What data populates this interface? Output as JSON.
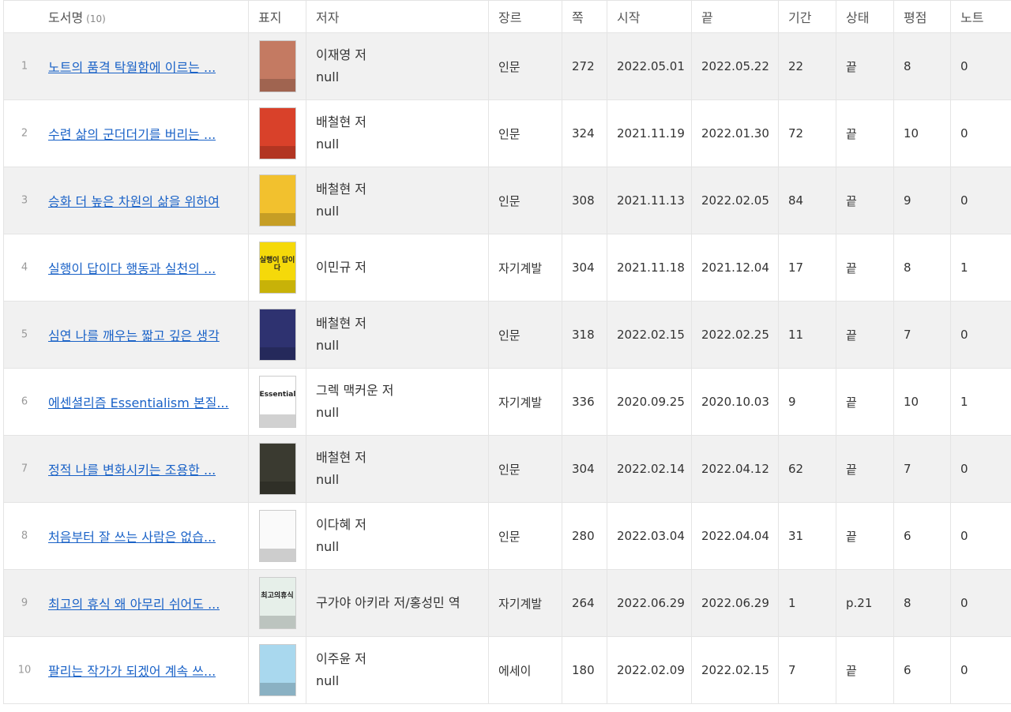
{
  "header": {
    "title": "도서명",
    "count": "(10)",
    "cover": "표지",
    "author": "저자",
    "genre": "장르",
    "pages": "쪽",
    "start": "시작",
    "end": "끝",
    "duration": "기간",
    "status": "상태",
    "rating": "평점",
    "note": "노트"
  },
  "books": [
    {
      "index": "1",
      "title": "노트의 품격 탁월함에 이르는 ...",
      "author": "이재영 저",
      "translator": "null",
      "genre": "인문",
      "pages": "272",
      "start": "2022.05.01",
      "end": "2022.05.22",
      "duration": "22",
      "status": "끝",
      "rating": "8",
      "note": "0",
      "cover_color": "#c47a62"
    },
    {
      "index": "2",
      "title": "수련 삶의 군더더기를 버리는 ...",
      "author": "배철현 저",
      "translator": "null",
      "genre": "인문",
      "pages": "324",
      "start": "2021.11.19",
      "end": "2022.01.30",
      "duration": "72",
      "status": "끝",
      "rating": "10",
      "note": "0",
      "cover_color": "#d9412a"
    },
    {
      "index": "3",
      "title": "승화 더 높은 차원의 삶을 위하여",
      "author": "배철현 저",
      "translator": "null",
      "genre": "인문",
      "pages": "308",
      "start": "2021.11.13",
      "end": "2022.02.05",
      "duration": "84",
      "status": "끝",
      "rating": "9",
      "note": "0",
      "cover_color": "#f2c12e"
    },
    {
      "index": "4",
      "title": "실행이 답이다 행동과 실천의 ...",
      "author": "이민규 저",
      "translator": "",
      "genre": "자기계발",
      "pages": "304",
      "start": "2021.11.18",
      "end": "2021.12.04",
      "duration": "17",
      "status": "끝",
      "rating": "8",
      "note": "1",
      "cover_color": "#f5d90a",
      "cover_text": "실행이 답이다"
    },
    {
      "index": "5",
      "title": "심연 나를 깨우는 짧고 깊은 생각",
      "author": "배철현 저",
      "translator": "null",
      "genre": "인문",
      "pages": "318",
      "start": "2022.02.15",
      "end": "2022.02.25",
      "duration": "11",
      "status": "끝",
      "rating": "7",
      "note": "0",
      "cover_color": "#2e3270"
    },
    {
      "index": "6",
      "title": "에센셜리즘 Essentialism 본질...",
      "author": "그렉 맥커운 저",
      "translator": "null",
      "genre": "자기계발",
      "pages": "336",
      "start": "2020.09.25",
      "end": "2020.10.03",
      "duration": "9",
      "status": "끝",
      "rating": "10",
      "note": "1",
      "cover_color": "#ffffff",
      "cover_text": "Essentialism"
    },
    {
      "index": "7",
      "title": "정적 나를 변화시키는 조용한 ...",
      "author": "배철현 저",
      "translator": "null",
      "genre": "인문",
      "pages": "304",
      "start": "2022.02.14",
      "end": "2022.04.12",
      "duration": "62",
      "status": "끝",
      "rating": "7",
      "note": "0",
      "cover_color": "#3a3a30"
    },
    {
      "index": "8",
      "title": "처음부터 잘 쓰는 사람은 없습...",
      "author": "이다혜 저",
      "translator": "null",
      "genre": "인문",
      "pages": "280",
      "start": "2022.03.04",
      "end": "2022.04.04",
      "duration": "31",
      "status": "끝",
      "rating": "6",
      "note": "0",
      "cover_color": "#fafafa"
    },
    {
      "index": "9",
      "title": "최고의 휴식 왜 아무리 쉬어도 ...",
      "author": "구가야 아키라 저/홍성민 역",
      "translator": "",
      "genre": "자기계발",
      "pages": "264",
      "start": "2022.06.29",
      "end": "2022.06.29",
      "duration": "1",
      "status": "p.21",
      "rating": "8",
      "note": "0",
      "cover_color": "#e6efe9",
      "cover_text": "최고의휴식"
    },
    {
      "index": "10",
      "title": "팔리는 작가가 되겠어 계속 쓰...",
      "author": "이주윤 저",
      "translator": "null",
      "genre": "에세이",
      "pages": "180",
      "start": "2022.02.09",
      "end": "2022.02.15",
      "duration": "7",
      "status": "끝",
      "rating": "6",
      "note": "0",
      "cover_color": "#a9d8ee"
    }
  ]
}
